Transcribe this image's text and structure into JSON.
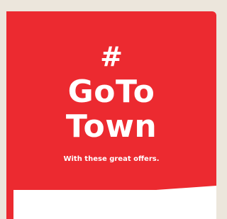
{
  "promo": {
    "hash": "#",
    "headline_line1": "GoTo",
    "headline_line2": "Town",
    "tagline": "With these great offers."
  },
  "colors": {
    "banner": "#ec2a30",
    "background": "#ece6dc",
    "panel": "#ffffff",
    "text": "#ffffff"
  }
}
